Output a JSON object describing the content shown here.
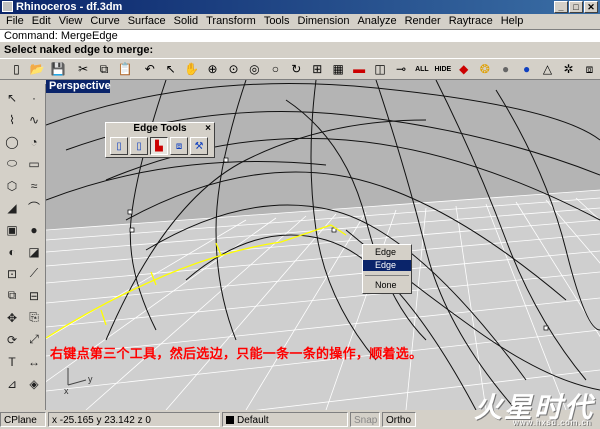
{
  "window": {
    "title": "Rhinoceros - df.3dm",
    "min": "_",
    "max": "□",
    "close": "✕"
  },
  "menu": [
    "File",
    "Edit",
    "View",
    "Curve",
    "Surface",
    "Solid",
    "Transform",
    "Tools",
    "Dimension",
    "Analyze",
    "Render",
    "Raytrace",
    "Help"
  ],
  "command": {
    "text": "Command: MergeEdge",
    "prompt": "Select naked edge to merge:"
  },
  "toolbar": {
    "all_label": "ALL",
    "hide_label": "HIDE",
    "icons": [
      "new-icon",
      "open-icon",
      "save-icon",
      "cut-icon",
      "copy-icon",
      "paste-icon",
      "undo-icon",
      "select-icon",
      "pan-icon",
      "zoom-window-icon",
      "zoom-dynamic-icon",
      "zoom-extents-icon",
      "zoom-selected-icon",
      "rotate-view-icon",
      "four-view-icon",
      "grid-icon",
      "car-icon",
      "layer-icon",
      "properties-icon",
      "show-icon",
      "hide-icon",
      "shade-icon",
      "color-wheel-icon",
      "sphere-icon",
      "environment-icon",
      "light-icon",
      "settings-icon",
      "render-icon"
    ]
  },
  "viewport": {
    "title": "Perspective"
  },
  "edge_tools": {
    "title": "Edge Tools",
    "close": "×"
  },
  "context_menu": {
    "items": [
      "Edge",
      "Edge",
      "None"
    ]
  },
  "annotation": "右键点第三个工具，然后选边，只能一条一条的操作，顺着选。",
  "status": {
    "cplane": "CPlane",
    "coords": "x -25.165  y 23.142  z 0",
    "layer": "Default",
    "snap": "Snap",
    "ortho": "Ortho"
  },
  "watermark": {
    "brand": "火星时代",
    "url": "www.hxsd.com.cn"
  }
}
